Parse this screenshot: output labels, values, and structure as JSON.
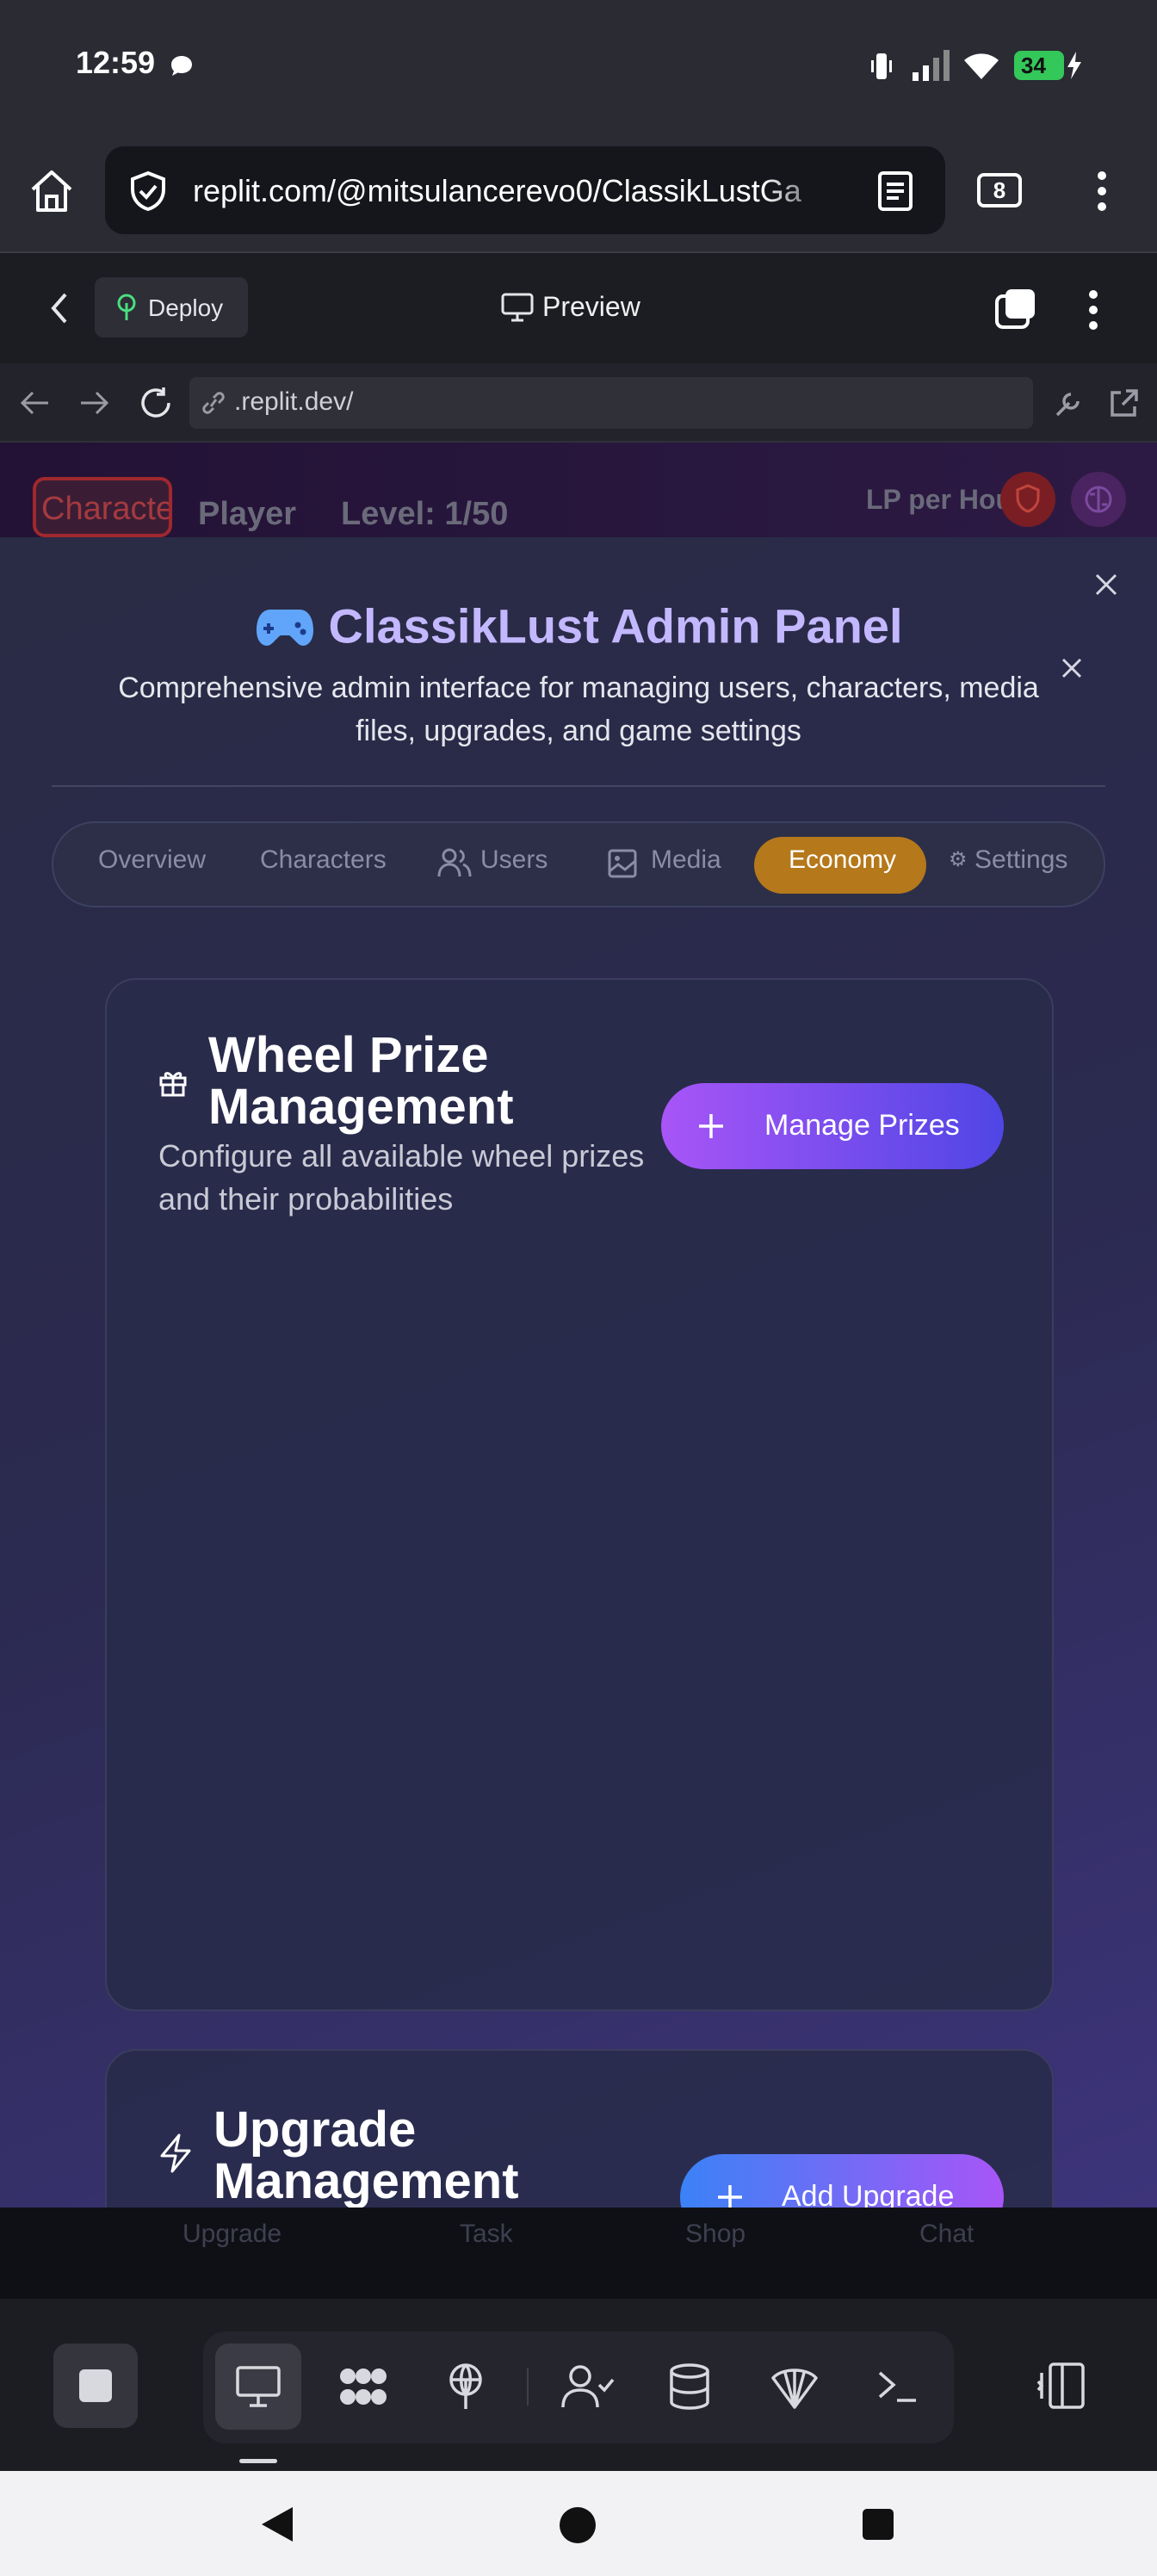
{
  "status_bar": {
    "time": "12:59",
    "battery": "34"
  },
  "browser": {
    "url": "replit.com/@mitsulancerevo0/ClassikLustGa",
    "tab_count": "8"
  },
  "replit_toolbar": {
    "deploy_label": "Deploy",
    "preview_label": "Preview"
  },
  "preview_nav": {
    "url": ".replit.dev/"
  },
  "game": {
    "character_button": "Characters",
    "player_label": "Player",
    "level_label": "Level: 1/50",
    "lp_label": "LP per Hour"
  },
  "admin_panel": {
    "title": "ClassikLust Admin Panel",
    "description": "Comprehensive admin interface for managing users, characters, media files, upgrades, and game settings",
    "tabs": [
      {
        "label": "Overview",
        "active": false
      },
      {
        "label": "Characters",
        "active": false
      },
      {
        "label": "Users",
        "active": false
      },
      {
        "label": "Media",
        "active": false
      },
      {
        "label": "Economy",
        "active": true
      },
      {
        "label": "Settings",
        "active": false
      }
    ],
    "wheel_card": {
      "title": "Wheel Prize Management",
      "description": "Configure all available wheel prizes and their probabilities",
      "button_label": "Manage Prizes"
    },
    "upgrade_card": {
      "title": "Upgrade Management",
      "button_label": "Add Upgrade"
    }
  },
  "game_nav": [
    "Upgrade",
    "Task",
    "Shop",
    "Chat"
  ],
  "colors": {
    "accent_economy": "#b5781a",
    "button_gradient_start": "#a855f7",
    "button_gradient_end": "#3b82f6"
  }
}
